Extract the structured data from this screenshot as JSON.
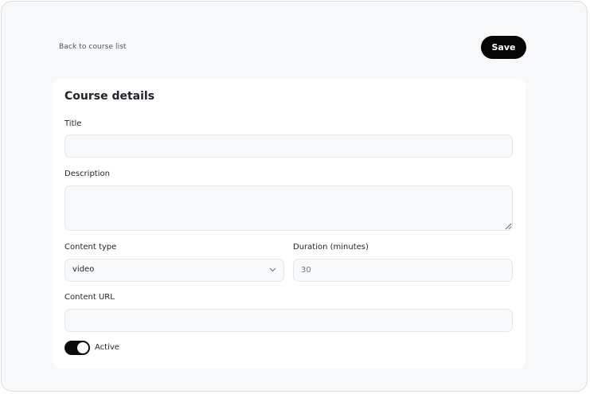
{
  "header": {
    "back_link": "Back to course list",
    "save_label": "Save"
  },
  "form": {
    "title": "Course details",
    "fields": {
      "title": {
        "label": "Title",
        "value": ""
      },
      "description": {
        "label": "Description",
        "value": ""
      },
      "content_type": {
        "label": "Content type",
        "value": "video"
      },
      "duration": {
        "label": "Duration (minutes)",
        "value": "30"
      },
      "content_url": {
        "label": "Content URL",
        "value": ""
      }
    },
    "active": {
      "label": "Active",
      "checked": true
    }
  },
  "colors": {
    "background": "#f7f8fa",
    "card": "#ffffff",
    "primary_button": "#050505",
    "toggle_on": "#0a0a0a",
    "input_background": "#f8f9fb",
    "input_border": "#e4e7ea"
  }
}
